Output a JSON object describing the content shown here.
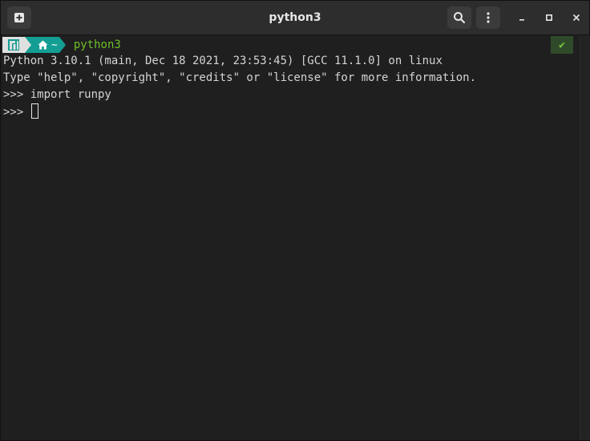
{
  "window": {
    "title": "python3"
  },
  "prompt": {
    "dir": "~",
    "command": "python3",
    "status": "✔"
  },
  "output": [
    "Python 3.10.1 (main, Dec 18 2021, 23:53:45) [GCC 11.1.0] on linux",
    "Type \"help\", \"copyright\", \"credits\" or \"license\" for more information.",
    ">>> import runpy"
  ],
  "input_prompt": ">>> ",
  "colors": {
    "accent": "#139e93",
    "command_text": "#6fbf2a",
    "status_ok": "#7ac943"
  },
  "icons": [
    "new-tab-icon",
    "search-icon",
    "menu-icon",
    "minimize-icon",
    "maximize-icon",
    "close-icon",
    "distro-logo-icon",
    "home-icon"
  ]
}
